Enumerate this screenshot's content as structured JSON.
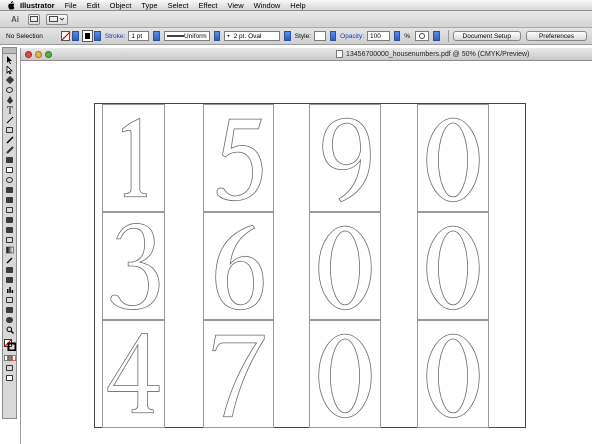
{
  "menubar": {
    "apple": "",
    "app_name": "Illustrator",
    "items": [
      "File",
      "Edit",
      "Object",
      "Type",
      "Select",
      "Effect",
      "View",
      "Window",
      "Help"
    ]
  },
  "app_toolbar": {
    "ai_label": "Ai"
  },
  "control_bar": {
    "selection_label": "No Selection",
    "stroke_label": "Stroke:",
    "stroke_weight": "1 pt",
    "profile_label": "Uniform",
    "brush_label": "2 pt. Oval",
    "style_label": "Style:",
    "opacity_label": "Opacity:",
    "opacity_value": "100",
    "percent": "%",
    "document_setup": "Document Setup",
    "preferences": "Preferences"
  },
  "document": {
    "title": "13456700000_housenumbers.pdf @ 50% (CMYK/Preview)"
  },
  "colors": {
    "close_light": "#e2493e",
    "minimize_light": "#e9b737",
    "zoom_light": "#52b545",
    "outline": "#6a6a6a"
  },
  "artboard": {
    "rows": [
      [
        "1",
        "5",
        "9",
        "0"
      ],
      [
        "3",
        "6",
        "0",
        "0"
      ],
      [
        "4",
        "7",
        "0",
        "0"
      ]
    ]
  }
}
